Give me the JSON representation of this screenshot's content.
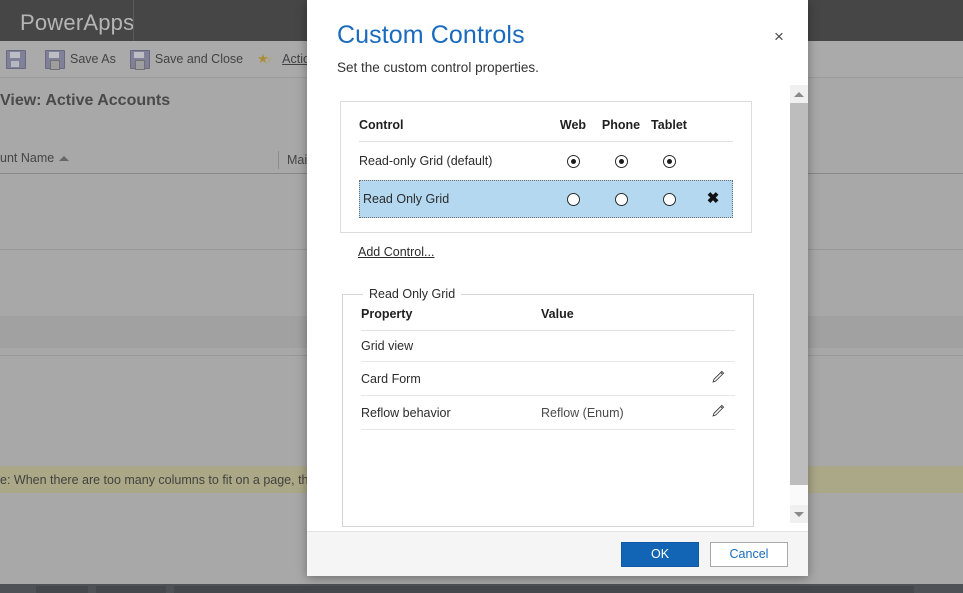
{
  "background": {
    "brand": "PowerApps",
    "toolbar": {
      "save_label": "",
      "save_as_label": "Save As",
      "save_and_close_label": "Save and Close",
      "actions_label": "Actions"
    },
    "view_title": "View: Active Accounts",
    "grid_columns": [
      "unt Name",
      "Main"
    ],
    "notice": "e: When there are too many columns to fit on a page, the view w"
  },
  "dialog": {
    "title": "Custom Controls",
    "subtitle": "Set the custom control properties.",
    "close_label": "×",
    "controls_table": {
      "headers": [
        "Control",
        "Web",
        "Phone",
        "Tablet"
      ],
      "rows": [
        {
          "name": "Read-only Grid (default)",
          "web": true,
          "phone": true,
          "tablet": true,
          "removable": false,
          "selected": false
        },
        {
          "name": "Read Only Grid",
          "web": false,
          "phone": false,
          "tablet": false,
          "removable": true,
          "remove_label": "✖",
          "selected": true
        }
      ],
      "add_control_label": "Add Control..."
    },
    "properties_panel": {
      "legend": "Read Only Grid",
      "headers": [
        "Property",
        "Value"
      ],
      "rows": [
        {
          "property": "Grid view",
          "value": "",
          "editable": false
        },
        {
          "property": "Card Form",
          "value": "",
          "editable": true
        },
        {
          "property": "Reflow behavior",
          "value": "Reflow (Enum)",
          "editable": true
        }
      ]
    },
    "footer": {
      "ok_label": "OK",
      "cancel_label": "Cancel"
    }
  },
  "colors": {
    "title_blue": "#1a6bbd",
    "primary_button": "#1265b5",
    "selected_row": "#b3d8f0",
    "notice_bar": "#cbc79a",
    "topbar": "#3f3f3f"
  }
}
